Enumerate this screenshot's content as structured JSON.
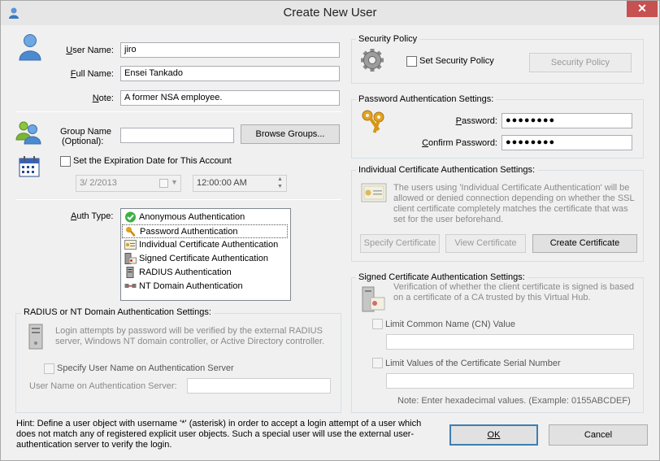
{
  "window": {
    "title": "Create New User",
    "close_glyph": "✕"
  },
  "user": {
    "username_label": "User Name:",
    "username_key": "U",
    "username_value": "jiro",
    "fullname_label": "Full Name:",
    "fullname_value": "Ensei Tankado",
    "note_label": "Note:",
    "note_value": "A former NSA employee."
  },
  "group": {
    "label_line1": "Group Name",
    "label_line2": "(Optional):",
    "value": "",
    "browse_button": "Browse Groups..."
  },
  "expiration": {
    "checkbox_label": "Set the Expiration Date for This Account",
    "checked": false,
    "date_value": "3/  2/2013",
    "time_value": "12:00:00 AM"
  },
  "auth": {
    "label": "Auth Type:",
    "options": [
      {
        "label": "Anonymous Authentication",
        "icon": "check-icon"
      },
      {
        "label": "Password Authentication",
        "icon": "key-icon"
      },
      {
        "label": "Individual Certificate Authentication",
        "icon": "certificate-icon"
      },
      {
        "label": "Signed Certificate Authentication",
        "icon": "server-cert-icon"
      },
      {
        "label": "RADIUS Authentication",
        "icon": "server-icon"
      },
      {
        "label": "NT Domain Authentication",
        "icon": "network-icon"
      }
    ],
    "selected": "Password Authentication"
  },
  "radius": {
    "group_title": "RADIUS or NT Domain Authentication Settings:",
    "description": "Login attempts by password will be verified by the external RADIUS server, Windows NT domain controller, or Active Directory controller.",
    "specify_checkbox": "Specify User Name on Authentication Server",
    "server_username_label": "User Name on Authentication Server:",
    "server_username_value": ""
  },
  "hint": "Hint: Define a user object with username '*' (asterisk) in order to accept a login attempt of a user which does not match any of registered explicit user objects. Such a special user will use the external user-authentication server to verify the login.",
  "security_policy": {
    "group_title": "Security Policy",
    "checkbox_label": "Set Security Policy",
    "button": "Security Policy"
  },
  "password": {
    "group_title": "Password Authentication Settings:",
    "password_label": "Password:",
    "password_value": "●●●●●●●●",
    "confirm_label": "Confirm Password:",
    "confirm_value": "●●●●●●●●"
  },
  "individual_cert": {
    "group_title": "Individual Certificate Authentication Settings:",
    "description": "The users using 'Individual Certificate Authentication' will be allowed or denied connection depending on whether the SSL client certificate completely matches the certificate that was set for the user beforehand.",
    "specify_button": "Specify Certificate",
    "view_button": "View Certificate",
    "create_button": "Create Certificate"
  },
  "signed_cert": {
    "group_title": "Signed Certificate Authentication Settings:",
    "description": "Verification of whether the client certificate is signed is based on a certificate of a CA trusted by this Virtual Hub.",
    "limit_cn_label": "Limit Common Name (CN) Value",
    "cn_value": "",
    "limit_serial_label": "Limit Values of the Certificate Serial Number",
    "serial_value": "",
    "note": "Note: Enter hexadecimal values. (Example: 0155ABCDEF)"
  },
  "footer": {
    "ok_button": "OK",
    "cancel_button": "Cancel"
  },
  "colors": {
    "title_bg": "#e6e6e6",
    "close_bg": "#c75050",
    "accent": "#3c7fb1"
  }
}
